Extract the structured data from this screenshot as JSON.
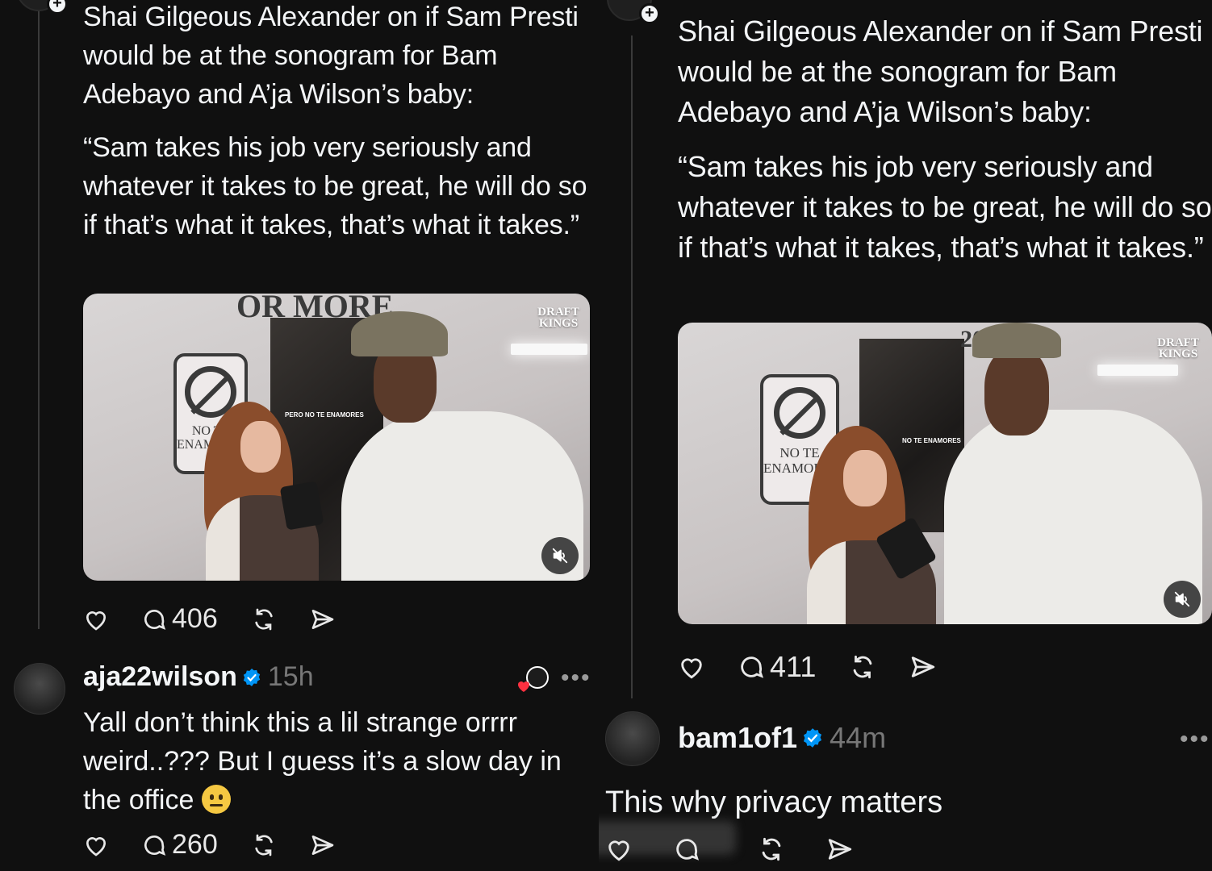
{
  "left": {
    "post": {
      "paragraphs": [
        "Shai Gilgeous Alexander on if Sam Presti would be at the sonogram for Bam Adebayo and A’ja Wilson’s baby:",
        "“Sam takes his job very seriously and whatever it takes to be great, he will do so if that’s what it takes, that’s what it takes.”"
      ],
      "media": {
        "brand": "DRAFT KINGS",
        "sign_text": "NO TE ENAMORES",
        "poster_text": "PERO NO TE ENAMORES",
        "wall_text": "OR MORE",
        "icon": "mute-icon"
      },
      "actions": {
        "reply_count": "406"
      }
    },
    "reply": {
      "username": "aja22wilson",
      "time": "15h",
      "more": "•••",
      "text": "Yall don’t think this a lil strange orrrr weird..??? But I guess it’s a slow day in the office",
      "emoji": "neutral-face",
      "actions": {
        "reply_count": "260"
      }
    }
  },
  "right": {
    "post": {
      "paragraphs": [
        "Shai Gilgeous Alexander on if Sam Presti would be at the sonogram for Bam Adebayo and A’ja Wilson’s baby:",
        "“Sam takes his job very seriously and whatever it takes to be great, he will do so if that’s what it takes, that’s what it takes.”"
      ],
      "media": {
        "brand": "DRAFT KINGS",
        "sign_text": "NO TE ENAMORES",
        "poster_text": "NO TE ENAMORES",
        "wall_text": "20",
        "icon": "mute-icon"
      },
      "actions": {
        "reply_count": "411"
      }
    },
    "reply": {
      "username": "bam1of1",
      "time": "44m",
      "more": "•••",
      "text": "This why privacy matters"
    }
  },
  "colors": {
    "background": "#101010",
    "text": "#f3f5f7",
    "muted": "#777777",
    "verified": "#0095f6"
  }
}
